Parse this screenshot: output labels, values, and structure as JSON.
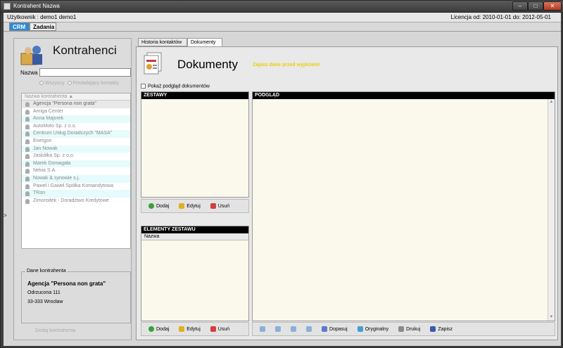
{
  "window": {
    "title": "Kontrahent Nazwa"
  },
  "userbar": {
    "user": "Użytkownik : demo1 demo1",
    "licence": "Licencja od: 2010-01-01 do: 2012-05-01"
  },
  "tabs": [
    "CRM",
    "Zadania"
  ],
  "left": {
    "title": "Kontrahenci",
    "search_label": "Nazwa",
    "search_value": "",
    "radio_all": "Wszyscy",
    "radio_recent": "Posiadający kontakty",
    "list_header": "Nazwa kontrahenta",
    "items": [
      "Agencja \"Persona non grata\"",
      "Amiga Center",
      "Anna Majorek",
      "AutoMoto Sp. z o.o.",
      "Centrum Usług Doradczych \"MASA\"",
      "Energon",
      "Jan Nowak",
      "Jaskółka Sp. z o.o.",
      "Marek Domagała",
      "Nekia S.A.",
      "Nowak & synowie s.j.",
      "Paweł i Gaweł Spółka Komandytowa",
      "TRon",
      "Zimorodek - Doradztwo Kredytowe"
    ],
    "dane_legend": "Dane kontrahenta",
    "dane_name": "Agencja \"Persona non grata\"",
    "dane_street": "Odrzucona 111",
    "dane_city": "33-333 Wrocław",
    "add_label": "Dodaj kontrahenta"
  },
  "right": {
    "subtabs": [
      "Historia kontaktów",
      "Dokumenty"
    ],
    "title": "Dokumenty",
    "warning": "Zapisz dane przed wyjściem!",
    "checkbox_label": "Pokaż podgląd dokumentów",
    "zestawy_header": "ZESTAWY",
    "elementy_header": "ELEMENTY ZESTAWU",
    "elementy_col": "Nazwa",
    "podglad_header": "PODGLĄD",
    "btn_add": "Dodaj",
    "btn_edit": "Edytuj",
    "btn_del": "Usuń",
    "btn_fit": "Dopasuj",
    "btn_orig": "Oryginalny",
    "btn_print": "Drukuj",
    "btn_save": "Zapisz"
  }
}
